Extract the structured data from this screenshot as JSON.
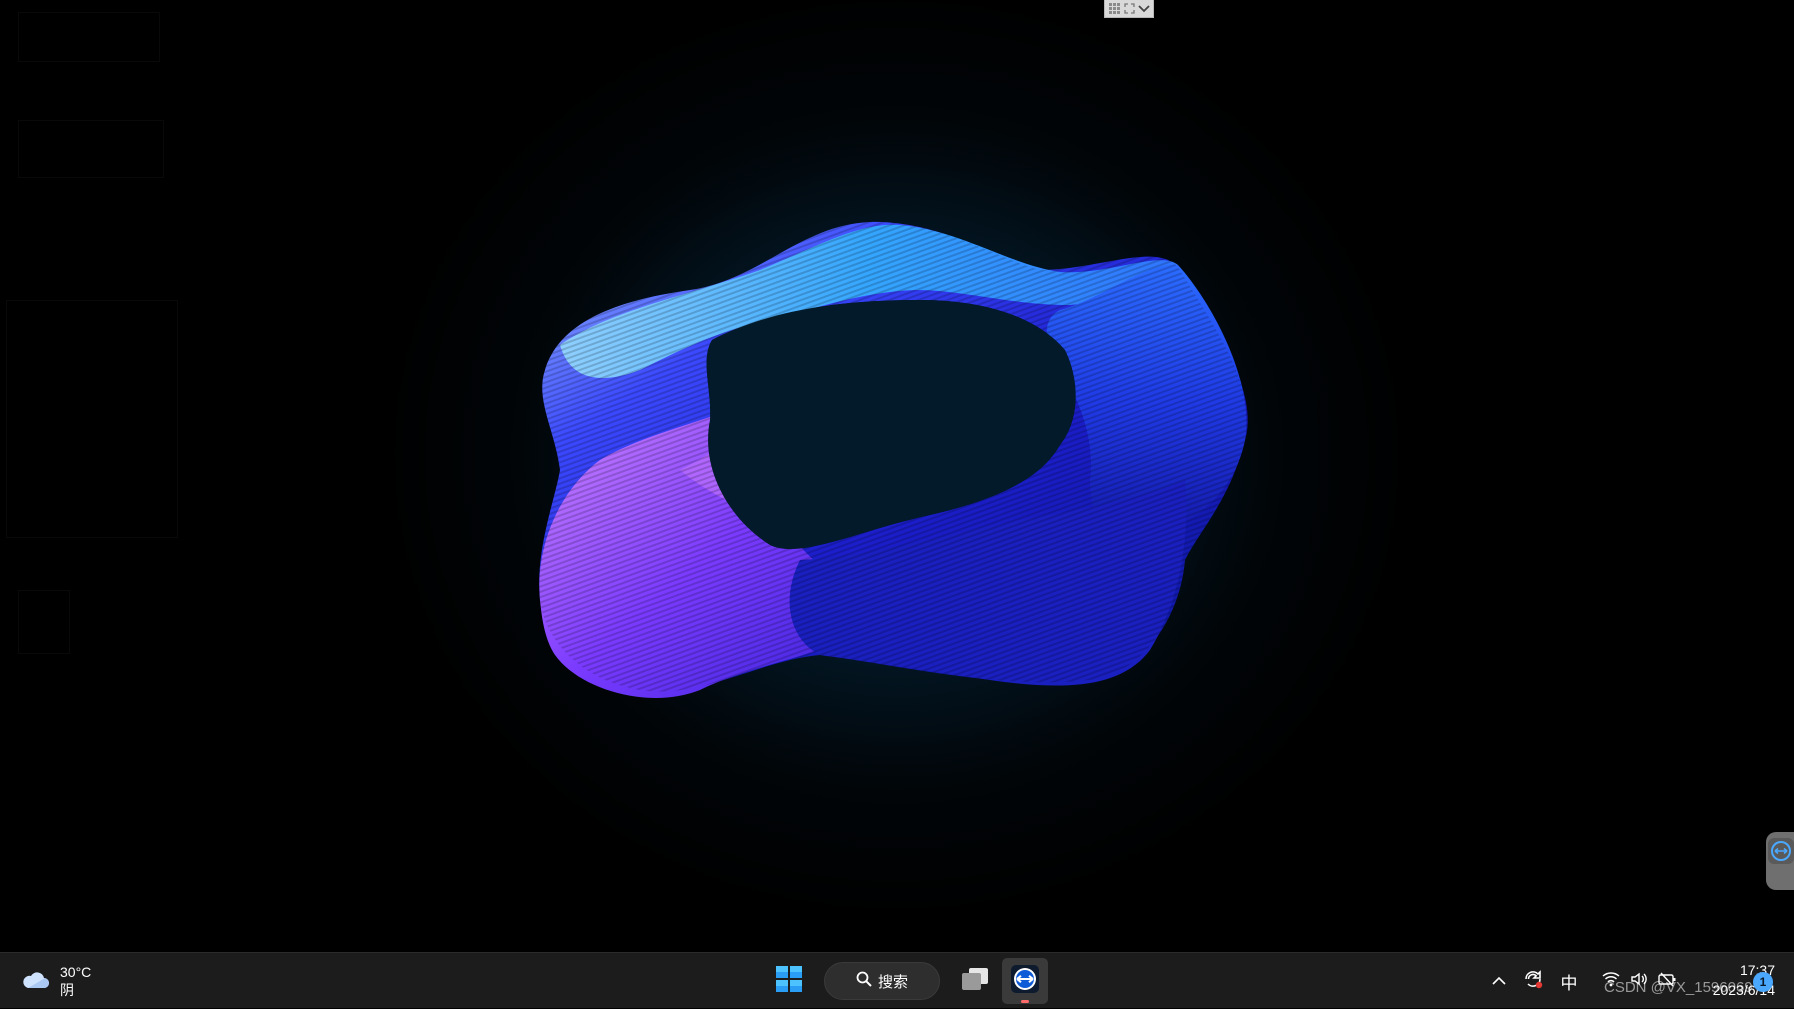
{
  "remote_toolbar": {
    "icons": [
      "grid-icon",
      "fullscreen-icon",
      "chevron-down-icon"
    ]
  },
  "taskbar": {
    "weather": {
      "temperature": "30°C",
      "condition": "阴",
      "icon": "cloud-icon"
    },
    "start": {
      "icon": "windows-logo-icon"
    },
    "search": {
      "label": "搜索",
      "icon": "search-icon"
    },
    "task_view": {
      "icon": "task-view-icon"
    },
    "pinned_app": {
      "icon": "teamviewer-icon",
      "running": true
    },
    "tray": {
      "chevron_icon": "chevron-up-icon",
      "sync_icon": "sync-icon",
      "ime_label": "中",
      "wifi_icon": "wifi-icon",
      "volume_icon": "volume-icon",
      "battery_icon": "battery-icon"
    },
    "clock": {
      "time": "17:37",
      "date": "2023/6/14"
    },
    "notification_count": "1"
  },
  "watermark": "CSDN @VX_1596069",
  "colors": {
    "taskbar": "#1c1c1c",
    "accent": "#4aa8ff",
    "running_indicator": "#ff6b6b"
  }
}
